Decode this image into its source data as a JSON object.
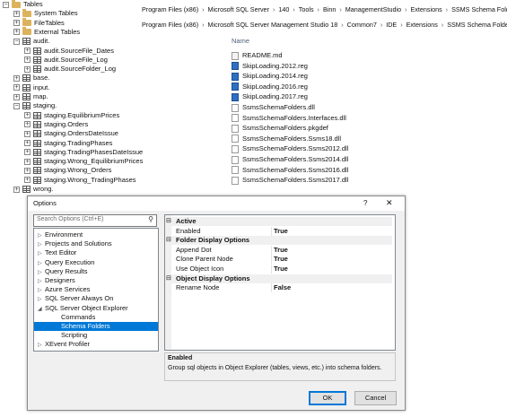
{
  "explorer": {
    "rows": [
      {
        "label": "Tables",
        "icon": "folder",
        "indent": 0,
        "expander": "−"
      },
      {
        "label": "System Tables",
        "icon": "folder",
        "indent": 1,
        "expander": "+"
      },
      {
        "label": "FileTables",
        "icon": "folder",
        "indent": 1,
        "expander": "+"
      },
      {
        "label": "External Tables",
        "icon": "folder",
        "indent": 1,
        "expander": "+"
      },
      {
        "label": "audit.",
        "icon": "table",
        "indent": 1,
        "expander": "−"
      },
      {
        "label": "audit.SourceFile_Dates",
        "icon": "table",
        "indent": 2,
        "expander": "+"
      },
      {
        "label": "audit.SourceFile_Log",
        "icon": "table",
        "indent": 2,
        "expander": "+"
      },
      {
        "label": "audit.SourceFolder_Log",
        "icon": "table",
        "indent": 2,
        "expander": "+"
      },
      {
        "label": "base.",
        "icon": "table",
        "indent": 1,
        "expander": "+"
      },
      {
        "label": "input.",
        "icon": "table",
        "indent": 1,
        "expander": "+"
      },
      {
        "label": "map.",
        "icon": "table",
        "indent": 1,
        "expander": "+"
      },
      {
        "label": "staging.",
        "icon": "table",
        "indent": 1,
        "expander": "−"
      },
      {
        "label": "staging.EquilibriumPrices",
        "icon": "table",
        "indent": 2,
        "expander": "+"
      },
      {
        "label": "staging.Orders",
        "icon": "table",
        "indent": 2,
        "expander": "+"
      },
      {
        "label": "staging.OrdersDateIssue",
        "icon": "table",
        "indent": 2,
        "expander": "+"
      },
      {
        "label": "staging.TradingPhases",
        "icon": "table",
        "indent": 2,
        "expander": "+"
      },
      {
        "label": "staging.TradingPhasesDateIssue",
        "icon": "table",
        "indent": 2,
        "expander": "+"
      },
      {
        "label": "staging.Wrong_EquilibriumPrices",
        "icon": "table",
        "indent": 2,
        "expander": "+"
      },
      {
        "label": "staging.Wrong_Orders",
        "icon": "table",
        "indent": 2,
        "expander": "+"
      },
      {
        "label": "staging.Wrong_TradingPhases",
        "icon": "table",
        "indent": 2,
        "expander": "+"
      },
      {
        "label": "wrong.",
        "icon": "table",
        "indent": 1,
        "expander": "+"
      }
    ]
  },
  "breadcrumb1": [
    "Program Files (x86)",
    "Microsoft SQL Server",
    "140",
    "Tools",
    "Binn",
    "ManagementStudio",
    "Extensions",
    "SSMS Schema Folders"
  ],
  "breadcrumb2": [
    "Program Files (x86)",
    "Microsoft SQL Server Management Studio 18",
    "Common7",
    "IDE",
    "Extensions",
    "SSMS Schema Folders"
  ],
  "files": {
    "column_name": "Name",
    "items": [
      {
        "name": "README.md",
        "type": "md"
      },
      {
        "name": "SkipLoading.2012.reg",
        "type": "reg"
      },
      {
        "name": "SkipLoading.2014.reg",
        "type": "reg"
      },
      {
        "name": "SkipLoading.2016.reg",
        "type": "reg"
      },
      {
        "name": "SkipLoading.2017.reg",
        "type": "reg"
      },
      {
        "name": "SsmsSchemaFolders.dll",
        "type": "dll"
      },
      {
        "name": "SsmsSchemaFolders.Interfaces.dll",
        "type": "dll"
      },
      {
        "name": "SsmsSchemaFolders.pkgdef",
        "type": "dll"
      },
      {
        "name": "SsmsSchemaFolders.Ssms18.dll",
        "type": "dll"
      },
      {
        "name": "SsmsSchemaFolders.Ssms2012.dll",
        "type": "dll"
      },
      {
        "name": "SsmsSchemaFolders.Ssms2014.dll",
        "type": "dll"
      },
      {
        "name": "SsmsSchemaFolders.Ssms2016.dll",
        "type": "dll"
      },
      {
        "name": "SsmsSchemaFolders.Ssms2017.dll",
        "type": "dll"
      }
    ]
  },
  "dialog": {
    "title": "Options",
    "help_label": "?",
    "close_label": "✕",
    "search_placeholder": "Search Options (Ctrl+E)",
    "options_tree": [
      {
        "label": "Environment",
        "arrow": "▷",
        "indent": 0
      },
      {
        "label": "Projects and Solutions",
        "arrow": "▷",
        "indent": 0
      },
      {
        "label": "Text Editor",
        "arrow": "▷",
        "indent": 0
      },
      {
        "label": "Query Execution",
        "arrow": "▷",
        "indent": 0
      },
      {
        "label": "Query Results",
        "arrow": "▷",
        "indent": 0
      },
      {
        "label": "Designers",
        "arrow": "▷",
        "indent": 0
      },
      {
        "label": "Azure Services",
        "arrow": "▷",
        "indent": 0
      },
      {
        "label": "SQL Server Always On",
        "arrow": "▷",
        "indent": 0
      },
      {
        "label": "SQL Server Object Explorer",
        "arrow": "◢",
        "indent": 0
      },
      {
        "label": "Commands",
        "arrow": "",
        "indent": 1
      },
      {
        "label": "Schema Folders",
        "arrow": "",
        "indent": 1,
        "selected": true
      },
      {
        "label": "Scripting",
        "arrow": "",
        "indent": 1
      },
      {
        "label": "XEvent Profiler",
        "arrow": "▷",
        "indent": 0
      }
    ],
    "property_grid": [
      {
        "category": "Active"
      },
      {
        "name": "Enabled",
        "value": "True"
      },
      {
        "category": "Folder Display Options"
      },
      {
        "name": "Append Dot",
        "value": "True"
      },
      {
        "name": "Clone Parent Node",
        "value": "True"
      },
      {
        "name": "Use Object Icon",
        "value": "True"
      },
      {
        "category": "Object Display Options"
      },
      {
        "name": "Rename Node",
        "value": "False"
      }
    ],
    "description_title": "Enabled",
    "description_text": "Group sql objects in Object Explorer (tables, views, etc.) into schema folders.",
    "ok_label": "OK",
    "cancel_label": "Cancel",
    "selection_color": "#0078d7"
  }
}
